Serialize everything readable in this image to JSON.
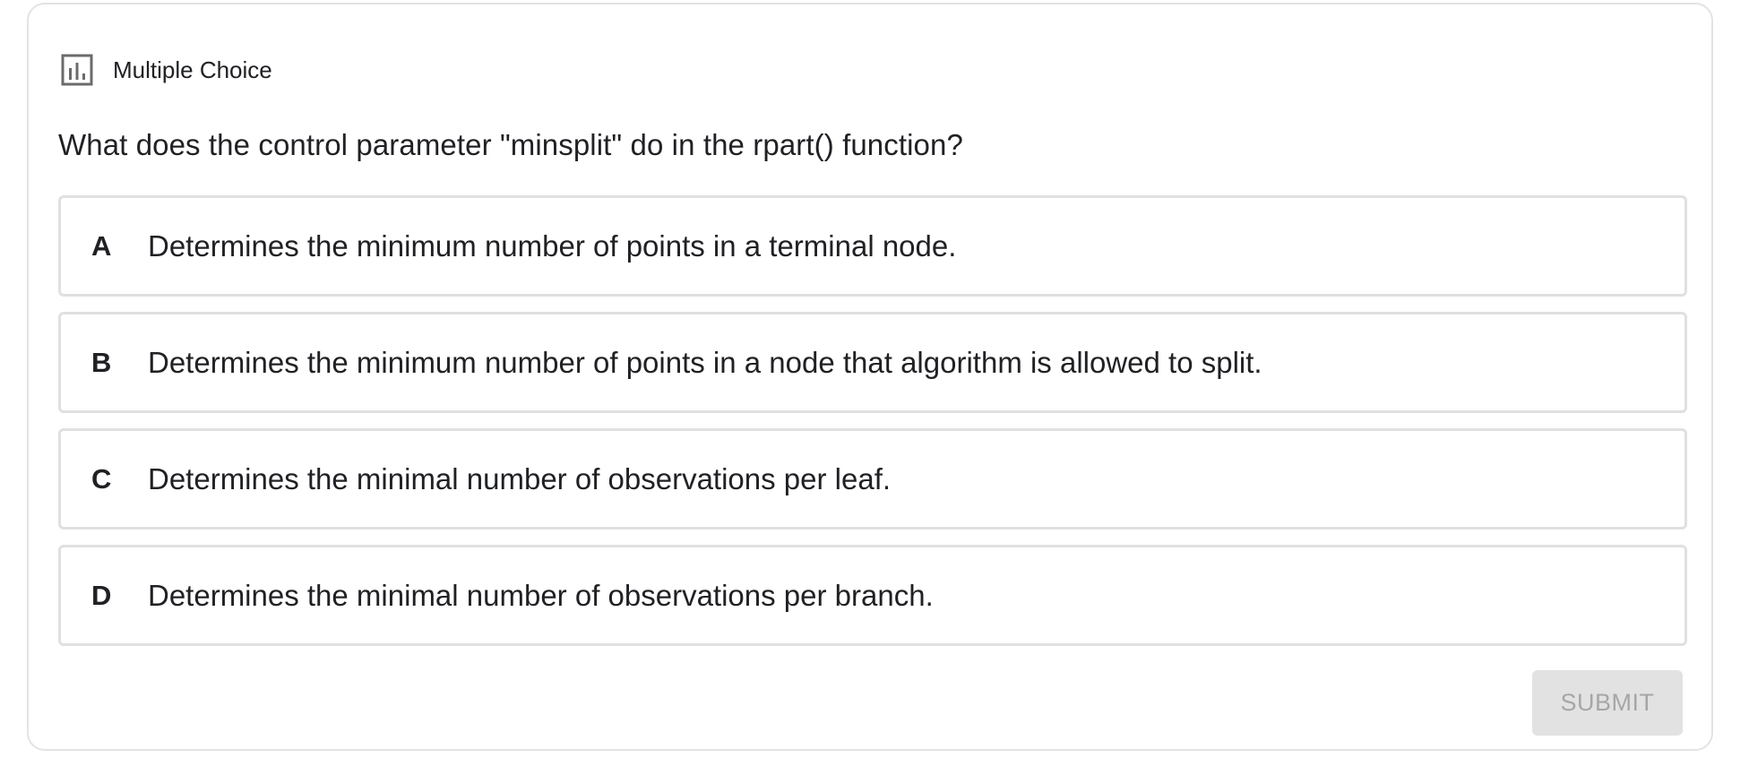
{
  "header": {
    "icon": "bar-chart-icon",
    "type_label": "Multiple Choice"
  },
  "question": {
    "text": "What does the control parameter \"minsplit\" do in the rpart() function?"
  },
  "options": [
    {
      "letter": "A",
      "text": "Determines the minimum number of points in a terminal node."
    },
    {
      "letter": "B",
      "text": "Determines the minimum number of points in a node that algorithm is allowed to split."
    },
    {
      "letter": "C",
      "text": "Determines the minimal number of observations per leaf."
    },
    {
      "letter": "D",
      "text": "Determines the minimal number of observations per branch."
    }
  ],
  "submit": {
    "label": "SUBMIT",
    "enabled": false
  },
  "colors": {
    "card_border": "#e3e3e3",
    "option_border": "#e0e0e0",
    "text": "#202124",
    "submit_bg": "#e2e2e2",
    "submit_text": "#a6a6a6"
  }
}
